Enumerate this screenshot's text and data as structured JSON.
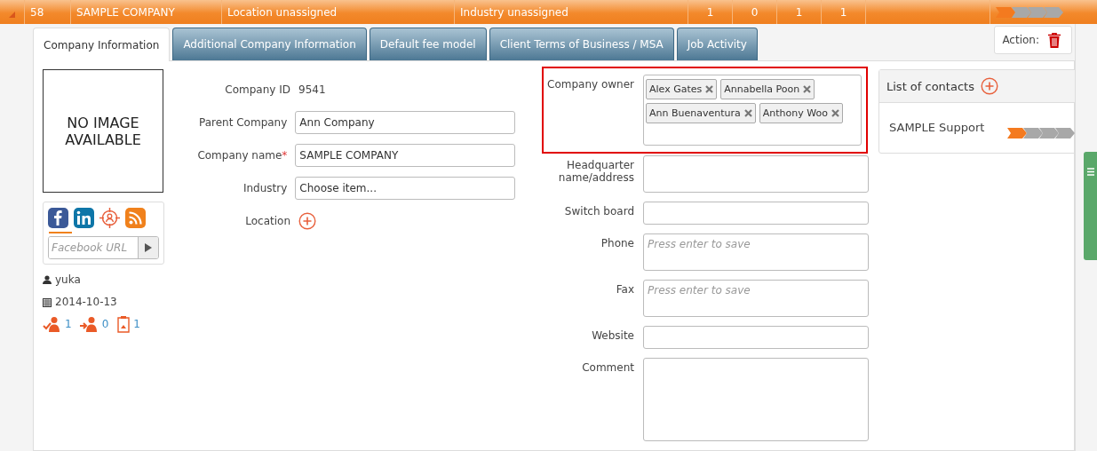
{
  "record_bar": {
    "expanded": true,
    "id": "58",
    "company": "SAMPLE COMPANY",
    "location": "Location unassigned",
    "industry": "Industry unassigned",
    "counts": [
      "1",
      "0",
      "1",
      "1"
    ],
    "stages": [
      {
        "done": true
      },
      {
        "done": false
      },
      {
        "done": false
      },
      {
        "done": false
      }
    ]
  },
  "tabs": [
    {
      "label": "Company Information",
      "selected": true
    },
    {
      "label": "Additional Company Information",
      "selected": false
    },
    {
      "label": "Default fee model",
      "selected": false
    },
    {
      "label": "Client Terms of Business / MSA",
      "selected": false
    },
    {
      "label": "Job Activity",
      "selected": false
    }
  ],
  "action": {
    "label": "Action:"
  },
  "logo": {
    "text": "NO IMAGE AVAILABLE"
  },
  "social": {
    "url_placeholder": "Facebook URL"
  },
  "meta": {
    "user": "yuka",
    "date": "2014-10-13",
    "counts": [
      "1",
      "0",
      "1"
    ]
  },
  "fields_left": [
    {
      "kind": "static",
      "label": "Company ID",
      "value": "9541"
    },
    {
      "kind": "input",
      "label": "Parent Company",
      "value": "Ann Company"
    },
    {
      "kind": "input",
      "label": "Company name",
      "required_mark": "*",
      "value": "SAMPLE COMPANY"
    },
    {
      "kind": "select",
      "label": "Industry",
      "value": "Choose item..."
    },
    {
      "kind": "add",
      "label": "Location"
    }
  ],
  "company_owner": {
    "label": "Company owner",
    "tags": [
      "Alex Gates",
      "Annabella Poon",
      "Ann Buenaventura",
      "Anthony Woo"
    ]
  },
  "fields_right": [
    {
      "kind": "textarea",
      "label": "Headquarter name/address"
    },
    {
      "kind": "input",
      "label": "Switch board"
    },
    {
      "kind": "textarea",
      "label": "Phone",
      "placeholder": "Press enter to save"
    },
    {
      "kind": "textarea",
      "label": "Fax",
      "placeholder": "Press enter to save"
    },
    {
      "kind": "input",
      "label": "Website"
    },
    {
      "kind": "big",
      "label": "Comment"
    }
  ],
  "contacts": {
    "title": "List of contacts",
    "items": [
      {
        "name": "SAMPLE Support",
        "stages": [
          {
            "done": true
          },
          {
            "done": false
          },
          {
            "done": false
          },
          {
            "done": false
          }
        ]
      }
    ]
  }
}
